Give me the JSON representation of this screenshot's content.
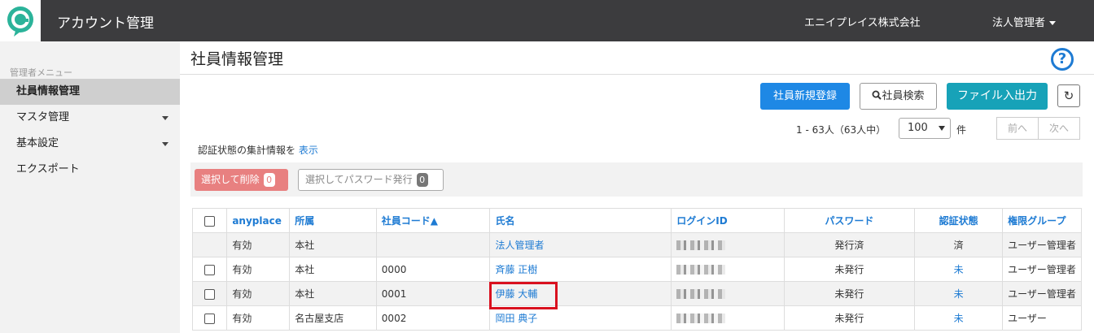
{
  "header": {
    "title": "アカウント管理",
    "company": "エニイプレイス株式会社",
    "user_menu": "法人管理者"
  },
  "sidebar": {
    "heading": "管理者メニュー",
    "items": [
      {
        "label": "社員情報管理",
        "active": true,
        "has_caret": false
      },
      {
        "label": "マスタ管理",
        "active": false,
        "has_caret": true
      },
      {
        "label": "基本設定",
        "active": false,
        "has_caret": true
      },
      {
        "label": "エクスポート",
        "active": false,
        "has_caret": false
      }
    ]
  },
  "page": {
    "title": "社員情報管理",
    "help_icon": "?"
  },
  "toolbar": {
    "register_label": "社員新規登録",
    "search_label": "社員検索",
    "file_label": "ファイル入出力",
    "refresh_icon": "↻"
  },
  "pagination": {
    "count_text": "1 - 63人（63人中）",
    "per_page": "100",
    "unit": "件",
    "prev": "前へ",
    "next": "次へ"
  },
  "auth_info": {
    "text": "認証状態の集計情報を",
    "link": "表示"
  },
  "actions": {
    "delete_label": "選択して削除",
    "delete_count": "0",
    "issue_pw_label": "選択してパスワード発行",
    "issue_pw_count": "0"
  },
  "table": {
    "headers": [
      "anyplace",
      "所属",
      "社員コード▲",
      "氏名",
      "ログインID",
      "パスワード",
      "認証状態",
      "権限グループ"
    ],
    "rows": [
      {
        "checkbox": false,
        "status": "有効",
        "dept": "本社",
        "code": "",
        "name": "法人管理者",
        "password": "発行済",
        "auth": "済",
        "auth_link": false,
        "group": "ユーザー管理者"
      },
      {
        "checkbox": true,
        "status": "有効",
        "dept": "本社",
        "code": "0000",
        "name": "斉藤 正樹",
        "password": "未発行",
        "auth": "未",
        "auth_link": true,
        "group": "ユーザー管理者"
      },
      {
        "checkbox": true,
        "status": "有効",
        "dept": "本社",
        "code": "0001",
        "name": "伊藤 大輔",
        "password": "未発行",
        "auth": "未",
        "auth_link": true,
        "group": "ユーザー管理者"
      },
      {
        "checkbox": true,
        "status": "有効",
        "dept": "名古屋支店",
        "code": "0002",
        "name": "岡田 典子",
        "password": "未発行",
        "auth": "未",
        "auth_link": true,
        "group": "ユーザー"
      }
    ]
  },
  "colors": {
    "topbar": "#3c3c3e",
    "primary": "#1e88e5",
    "info": "#17a2b8",
    "danger": "#e88080",
    "highlight": "#d9111f"
  }
}
